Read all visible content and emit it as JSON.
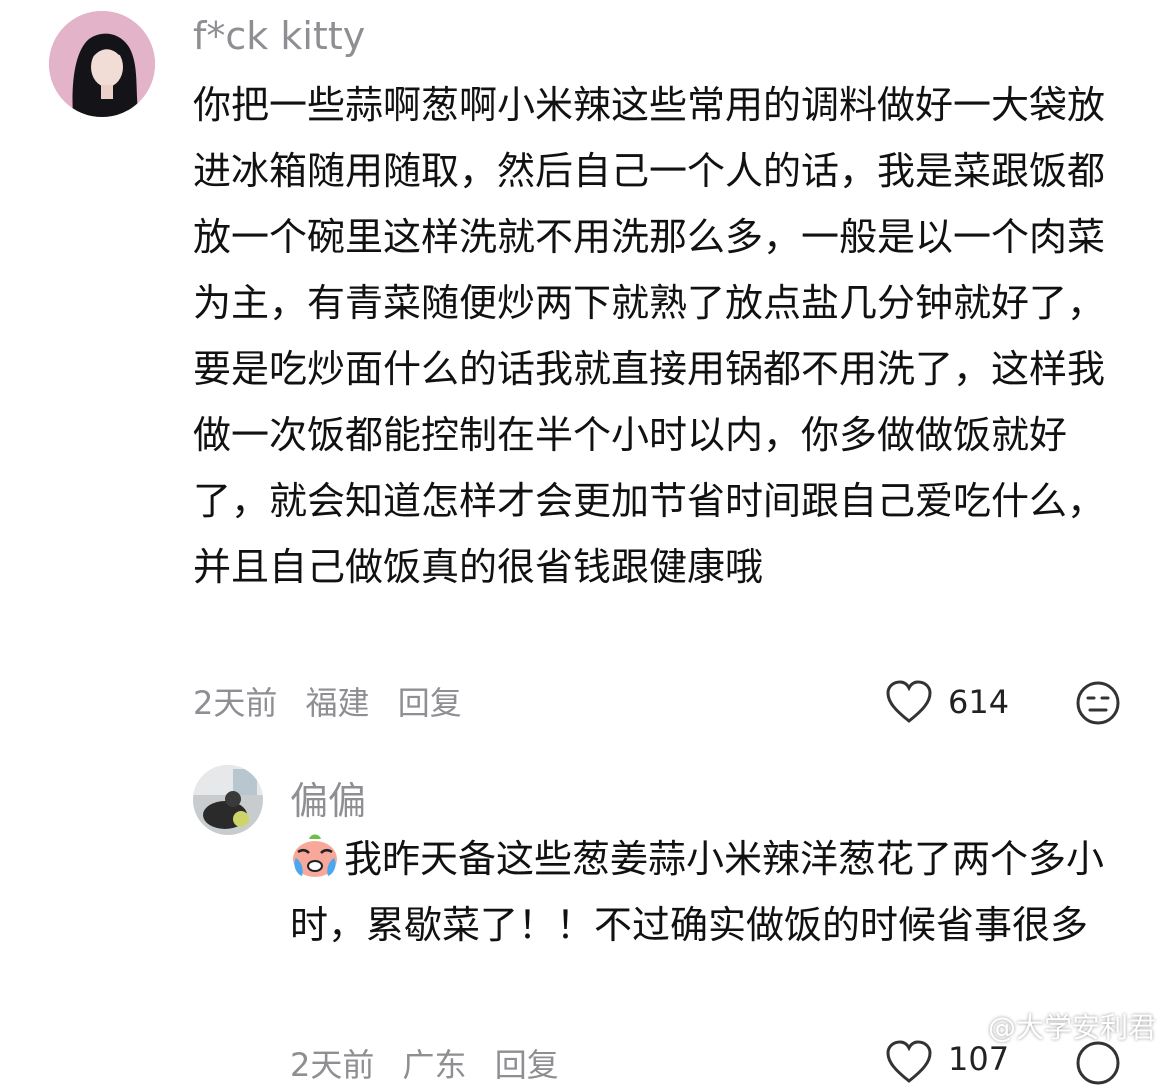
{
  "comment1": {
    "username": "f*ck kitty",
    "text": "你把一些蒜啊葱啊小米辣这些常用的调料做好一大袋放进冰箱随用随取，然后自己一个人的话，我是菜跟饭都放一个碗里这样洗就不用洗那么多，一般是以一个肉菜为主，有青菜随便炒两下就熟了放点盐几分钟就好了，要是吃炒面什么的话我就直接用锅都不用洗了，这样我做一次饭都能控制在半个小时以内，你多做做饭就好了，就会知道怎样才会更加节省时间跟自己爱吃什么，并且自己做饭真的很省钱跟健康哦",
    "time": "2天前",
    "location": "福建",
    "reply_label": "回复",
    "like_count": "614",
    "like_icon": "heart-outline-icon",
    "reaction_icon": "meh-face-icon"
  },
  "reply1": {
    "username": "偏偏",
    "emoji": "crying-face-emoji",
    "text": "我昨天备这些葱姜蒜小米辣洋葱花了两个多小时，累歇菜了！！不过确实做饭的时候省事很多",
    "time": "2天前",
    "location": "广东",
    "reply_label": "回复",
    "like_count": "107"
  },
  "watermark": {
    "text": "@大学安利君",
    "icon": "weibo-logo-icon"
  }
}
